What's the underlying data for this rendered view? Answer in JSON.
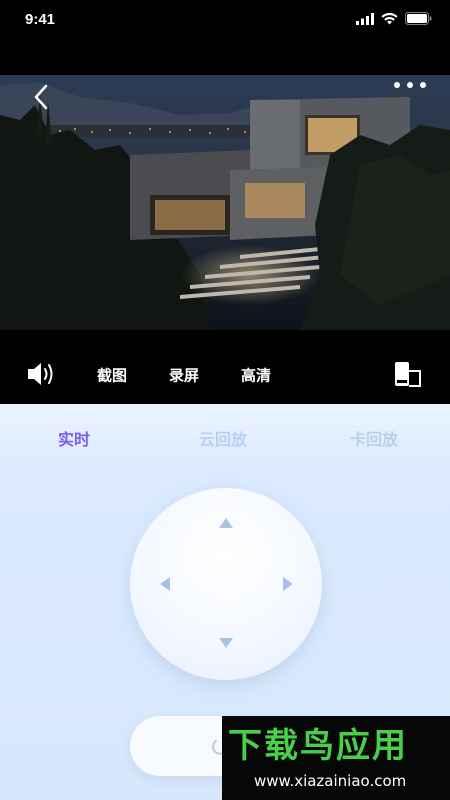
{
  "status": {
    "time": "9:41"
  },
  "toolbar": {
    "screenshot_label": "截图",
    "record_label": "录屏",
    "quality_label": "高清"
  },
  "tabs": [
    {
      "label": "实时",
      "active": true
    },
    {
      "label": "云回放",
      "active": false
    },
    {
      "label": "卡回放",
      "active": false
    }
  ],
  "watermark": {
    "title": "下载鸟应用",
    "url": "www.xiazainiao.com"
  },
  "colors": {
    "active_tab": "#7d5cf0",
    "inactive_tab": "#b9d1ef",
    "panel_bg": "#dbeaff",
    "watermark_green": "#48d04a"
  },
  "icons": [
    "back-chevron-icon",
    "more-dots-icon",
    "volume-icon",
    "rotate-screen-icon",
    "signal-icon",
    "wifi-icon",
    "battery-icon"
  ]
}
